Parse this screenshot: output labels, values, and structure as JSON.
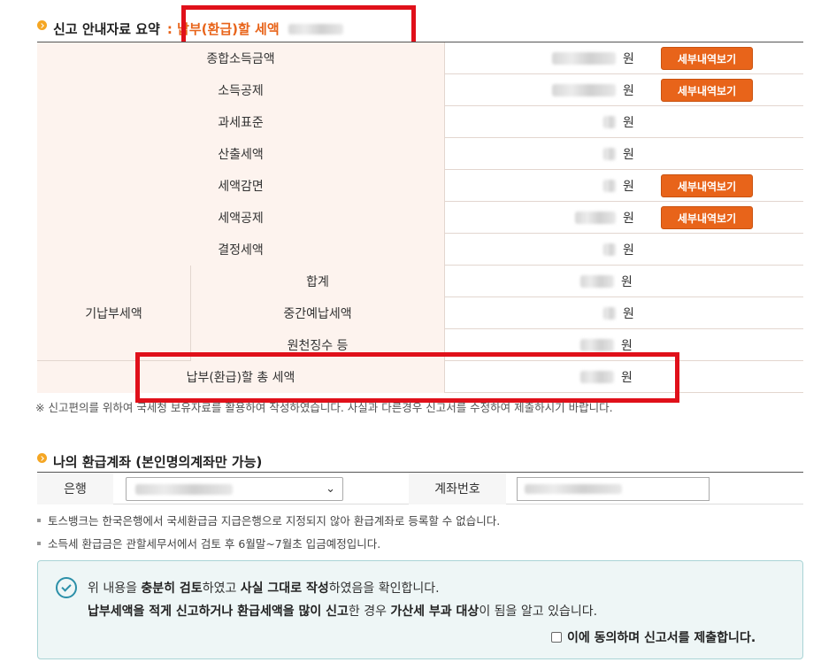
{
  "summary": {
    "title": "신고 안내자료 요약",
    "subtitle": ": 납부(환급)할 세액",
    "rows": [
      {
        "label": "종합소득금액",
        "unit": "원",
        "button": "세부내역보기"
      },
      {
        "label": "소득공제",
        "unit": "원",
        "button": "세부내역보기"
      },
      {
        "label": "과세표준",
        "unit": "원"
      },
      {
        "label": "산출세액",
        "unit": "원"
      },
      {
        "label": "세액감면",
        "unit": "원",
        "button": "세부내역보기"
      },
      {
        "label": "세액공제",
        "unit": "원",
        "button": "세부내역보기"
      },
      {
        "label": "결정세액",
        "unit": "원"
      }
    ],
    "prepaid": {
      "label": "기납부세액",
      "rows": [
        {
          "label": "합계",
          "unit": "원"
        },
        {
          "label": "중간예납세액",
          "unit": "원"
        },
        {
          "label": "원천징수 등",
          "unit": "원"
        }
      ]
    },
    "total": {
      "label": "납부(환급)할 총 세액",
      "unit": "원"
    },
    "note": "※ 신고편의를 위하여 국세청 보유자료를 활용하여 작성하였습니다. 사실과 다른경우 신고서를 수정하여 제출하시기 바랍니다."
  },
  "refund": {
    "title": "나의 환급계좌 (본인명의계좌만 가능)",
    "bank_label": "은행",
    "account_label": "계좌번호",
    "info": [
      "토스뱅크는 한국은행에서 국세환급금 지급은행으로 지정되지 않아 환급계좌로 등록할 수 없습니다.",
      "소득세 환급금은 관할세무서에서 검토 후 6월말~7월초 입금예정입니다."
    ]
  },
  "confirm": {
    "line1_a": "위 내용을 ",
    "line1_b": "충분히 검토",
    "line1_c": "하였고 ",
    "line1_d": "사실 그대로 작성",
    "line1_e": "하였음을 확인합니다.",
    "line2_a": "납부세액을 적게 신고하거나 환급세액을 많이 신고",
    "line2_b": "한 경우 ",
    "line2_c": "가산세 부과 대상",
    "line2_d": "이 됨을 알고 있습니다.",
    "agree_label": "이에 동의하며 신고서를 제출합니다."
  }
}
